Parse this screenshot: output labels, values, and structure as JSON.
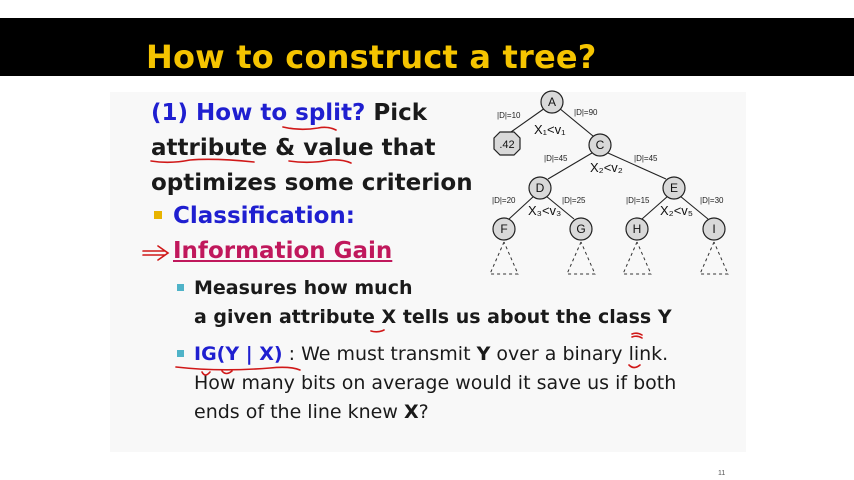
{
  "slide": {
    "title": "How to construct a tree?",
    "line1_label": "(1) How to split?",
    "line1_rest": " Pick",
    "line2": "attribute & value that",
    "line3": "optimizes some criterion",
    "bullet1": "Classification:",
    "bullet2": "Information Gain",
    "sub1_line1": "Measures how much",
    "sub1_line2_a": "a given attribute ",
    "sub1_line2_x": "X",
    "sub1_line2_b": " tells us about the class ",
    "sub1_line2_y": "Y",
    "sub2_ig": "IG(Y | X)",
    "sub2_a": " : We must transmit ",
    "sub2_y": "Y",
    "sub2_b": " over a binary link.",
    "sub2_line2": "How many bits on average would it save us if both",
    "sub2_line3_a": "ends of the line knew ",
    "sub2_line3_x": "X",
    "sub2_line3_b": "?",
    "page_number": "11"
  },
  "tree": {
    "nodes": {
      "A": "A",
      "C": "C",
      "D": "D",
      "E": "E",
      "F": "F",
      "G": "G",
      "H": "H",
      "I": "I",
      "leaf": ".42"
    },
    "edge_labels": {
      "a_left": "|D|=10",
      "a_right": "|D|=90",
      "c_left": "|D|=45",
      "c_right": "|D|=45",
      "d_left": "|D|=20",
      "d_right": "|D|=25",
      "e_left": "|D|=15",
      "e_right": "|D|=30"
    },
    "splits": {
      "a": "X₁<v₁",
      "c": "X₂<v₂",
      "d": "X₃<v₃",
      "e": "X₂<v₅"
    }
  },
  "colors": {
    "title_bar": "#000000",
    "title_text": "#f5c400",
    "heading_blue": "#1f1fd0",
    "highlight_magenta": "#c0185c",
    "bullet_yellow": "#e8b400",
    "bullet_teal": "#4fb3c8",
    "ink_red": "#d01818"
  }
}
